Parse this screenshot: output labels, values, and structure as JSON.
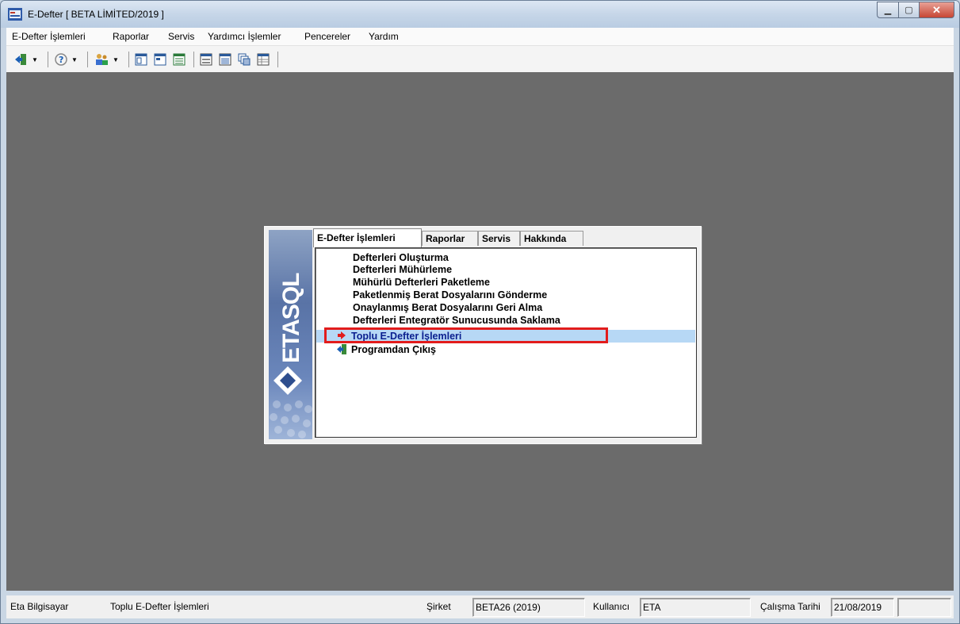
{
  "window": {
    "title": "E-Defter [ BETA LİMİTED/2019 ]"
  },
  "menu": {
    "items": [
      "E-Defter İşlemleri",
      "Raporlar",
      "Servis",
      "Yardımcı İşlemler",
      "Pencereler",
      "Yardım"
    ]
  },
  "toolbar": {
    "icons": [
      "exit-icon",
      "help-icon",
      "users-icon",
      "window-icon",
      "window-alt-icon",
      "list-window-icon",
      "form-icon",
      "report-icon",
      "cascade-icon",
      "grid-icon"
    ]
  },
  "panel": {
    "logo_text": "ETASQL",
    "tabs": [
      "E-Defter İşlemleri",
      "Raporlar",
      "Servis",
      "Hakkında"
    ],
    "active_tab": 0,
    "items": [
      "Defterleri Oluşturma",
      "Defterleri Mühürleme",
      "Mühürlü Defterleri Paketleme",
      "Paketlenmiş Berat Dosyalarını Gönderme",
      "Onaylanmış Berat Dosyalarını Geri Alma",
      "Defterleri Entegratör Sunucusunda Saklama",
      "Toplu E-Defter İşlemleri",
      "Programdan Çıkış"
    ],
    "selected_index": 6,
    "highlight_color": "#e21c1c"
  },
  "status": {
    "company_name": "Eta Bilgisayar",
    "current_action": "Toplu E-Defter İşlemleri",
    "firm_label": "Şirket",
    "firm_value": "BETA26 (2019)",
    "user_label": "Kullanıcı",
    "user_value": "ETA",
    "date_label": "Çalışma Tarihi",
    "date_value": "21/08/2019"
  }
}
